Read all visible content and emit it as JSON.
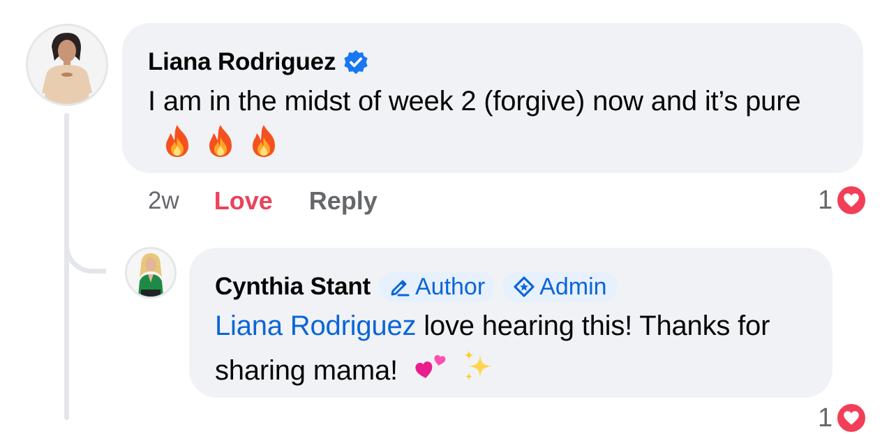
{
  "comment": {
    "author": "Liana Rodriguez",
    "verified": true,
    "text": "I am in the midst of week 2 (forgive) now and it’s pure",
    "emojis": [
      "fire",
      "fire",
      "fire"
    ],
    "time": "2w",
    "love_label": "Love",
    "reply_label": "Reply",
    "reaction_count": "1",
    "reaction_type": "heart"
  },
  "reply": {
    "author": "Cynthia Stant",
    "badges": [
      {
        "label": "Author",
        "icon": "pencil-icon"
      },
      {
        "label": "Admin",
        "icon": "shield-star-icon"
      }
    ],
    "mention": "Liana Rodriguez",
    "text": " love hearing this! Thanks for sharing mama!",
    "emojis": [
      "two-hearts",
      "sparkles"
    ],
    "reaction_count": "1"
  },
  "colors": {
    "bubble_bg": "#f0f2f5",
    "link_blue": "#0a65d8",
    "love_red": "#e8445a",
    "muted_gray": "#65676b",
    "heart_red": "#f33e58"
  }
}
